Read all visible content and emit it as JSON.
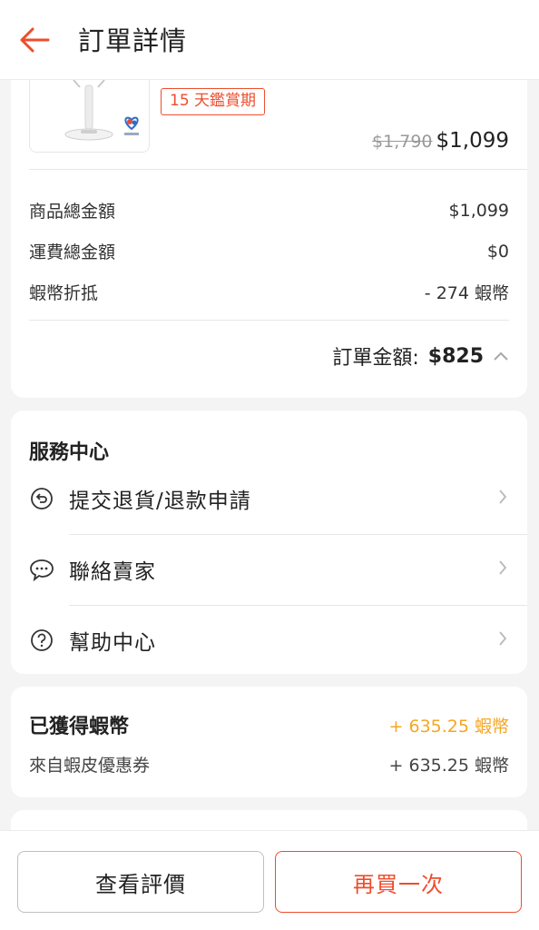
{
  "header": {
    "title": "訂單詳情"
  },
  "product": {
    "tag": "15 天鑑賞期",
    "old_price": "$1,790",
    "price": "$1,099"
  },
  "summary": {
    "rows": [
      {
        "label": "商品總金額",
        "value": "$1,099"
      },
      {
        "label": "運費總金額",
        "value": "$0"
      },
      {
        "label": "蝦幣折抵",
        "value": "- 274 蝦幣"
      }
    ],
    "total_label": "訂單金額:",
    "total_value": "$825"
  },
  "service": {
    "title": "服務中心",
    "items": [
      {
        "label": "提交退貨/退款申請",
        "icon": "return-icon"
      },
      {
        "label": "聯絡賣家",
        "icon": "chat-icon"
      },
      {
        "label": "幫助中心",
        "icon": "help-icon"
      }
    ]
  },
  "coins": {
    "title": "已獲得蝦幣",
    "total": "+ 635.25 蝦幣",
    "source_label": "來自蝦皮優惠券",
    "source_value": "+ 635.25 蝦幣"
  },
  "actions": {
    "review_label": "查看評價",
    "buy_again_label": "再買一次"
  },
  "colors": {
    "accent": "#ee4d2d",
    "coins": "#f5a623"
  }
}
